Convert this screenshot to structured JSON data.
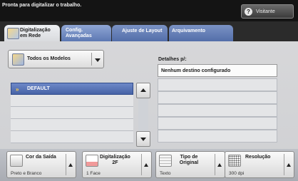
{
  "status_text": "Pronta para digitalizar o trabalho.",
  "user_button": {
    "icon": "help-icon",
    "label": "Visitante"
  },
  "tabs": [
    {
      "label_line1": "Digitalização",
      "label_line2": "em Rede",
      "icon": "network-scan-icon",
      "active": true
    },
    {
      "label_line1": "Config.",
      "label_line2": "Avançadas",
      "active": false
    },
    {
      "label_line1": "Ajuste de Layout",
      "label_line2": "",
      "active": false
    },
    {
      "label_line1": "Arquivamento",
      "label_line2": "",
      "active": false
    }
  ],
  "templates_dropdown": {
    "label": "Todos os Modelos",
    "icon": "templates-icon"
  },
  "template_list": [
    {
      "label": "DEFAULT",
      "selected": true
    },
    {
      "label": ""
    },
    {
      "label": ""
    },
    {
      "label": ""
    },
    {
      "label": ""
    }
  ],
  "details": {
    "label": "Detalhes p/:",
    "rows": [
      "Nenhum destino configurado",
      "",
      "",
      "",
      "",
      ""
    ]
  },
  "features": [
    {
      "title_line1": "Cor da Saída",
      "title_line2": "",
      "value": "Preto e Branco",
      "icon": "output-color-icon"
    },
    {
      "title_line1": "Digitalização",
      "title_line2": "2F",
      "value": "1 Face",
      "icon": "2-sided-scan-icon"
    },
    {
      "title_line1": "Tipo de",
      "title_line2": "Original",
      "value": "Texto",
      "icon": "original-type-icon"
    },
    {
      "title_line1": "Resolução",
      "title_line2": "",
      "value": "300 dpi",
      "icon": "resolution-icon"
    }
  ],
  "colors": {
    "top_bar": "#141414",
    "tab_blue": "#5d78b3",
    "selection_blue": "#4763a7",
    "chevron_yellow": "#ffd24a"
  }
}
